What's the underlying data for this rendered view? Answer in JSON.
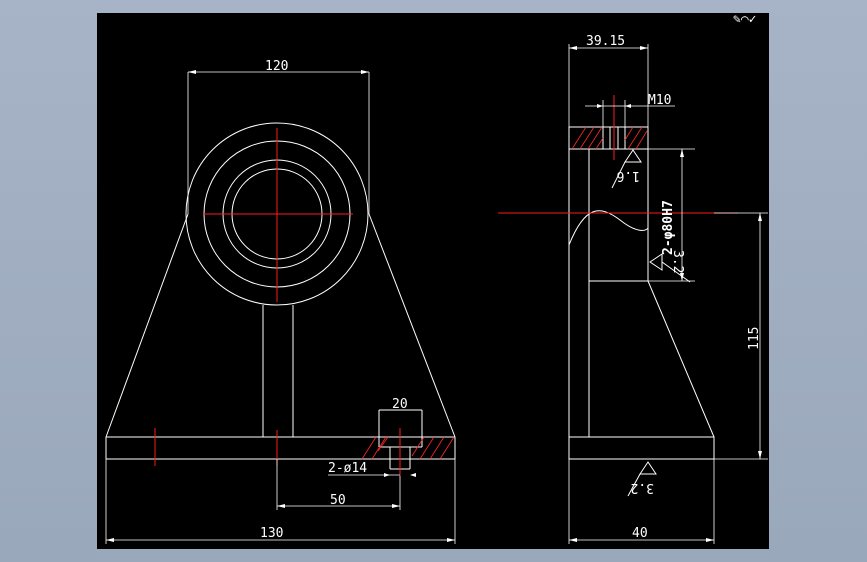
{
  "colors": {
    "background": "#9aa8bc",
    "sheet": "#000000",
    "outline": "#ffffff",
    "centerline": "#ff1a1a",
    "hatch": "#ff2a2a"
  },
  "dimensions": {
    "top_width": "120",
    "boss_width": "20",
    "hole_spec": "2-ø14",
    "hole_offset": "50",
    "overall_width": "130",
    "side_top_width": "39.15",
    "thread": "M10",
    "bore_spec": "2-φ80H7",
    "height": "115",
    "side_base_width": "40"
  },
  "surface_finish": {
    "top": "1.6",
    "bore": "3.2",
    "bottom": "3.2"
  },
  "corner_mark": "✎⌒✓"
}
